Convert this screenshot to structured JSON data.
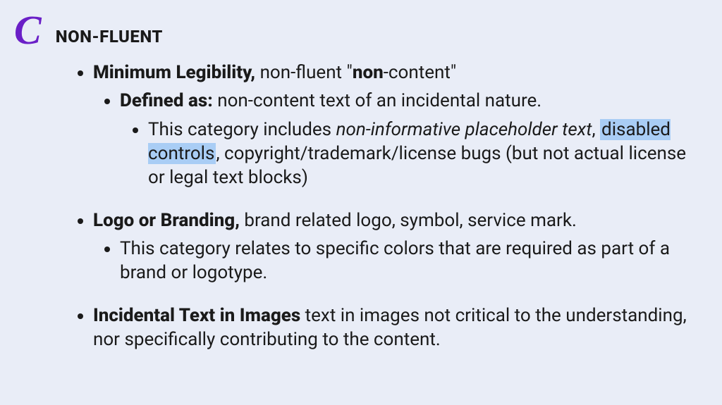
{
  "header": {
    "letter": "C",
    "title": "NON-FLUENT"
  },
  "item1": {
    "label": "Minimum Legibility,",
    "desc1": " non-fluent \"",
    "desc_bold": "non",
    "desc2": "-content\"",
    "sub": {
      "label": "Defined as:",
      "desc": " non-content text of an incidental nature.",
      "detail": {
        "t1": "This category includes ",
        "em": "non-informative placeholder text",
        "t2": ", ",
        "hl": "disabled controls",
        "t3": ", copyright/trademark/license bugs (but not actual license or legal text blocks)"
      }
    }
  },
  "item2": {
    "label": "Logo or Branding,",
    "desc": " brand related logo, symbol, service mark.",
    "sub": "This category relates to specific colors that are required as part of a brand or logotype."
  },
  "item3": {
    "label": "Incidental Text in Images",
    "desc": " text in images not critical to the understanding, nor specifically contributing to the content."
  }
}
